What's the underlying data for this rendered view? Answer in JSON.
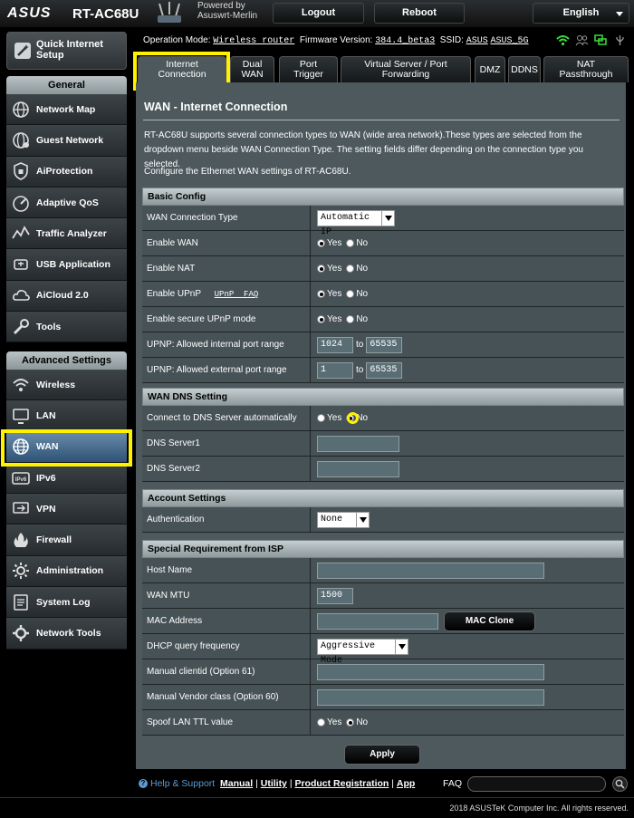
{
  "header": {
    "logo": "ASUS",
    "model": "RT-AC68U",
    "powered_by": "Powered by",
    "firmware_brand": "Asuswrt-Merlin",
    "logout": "Logout",
    "reboot": "Reboot",
    "language": "English"
  },
  "status": {
    "op_mode_label": "Operation Mode:",
    "op_mode": "Wireless router",
    "fw_label": "Firmware Version:",
    "fw": "384.4_beta3",
    "ssid_label": "SSID:",
    "ssid1": "ASUS",
    "ssid2": "ASUS_5G"
  },
  "sidebar": {
    "qis": "Quick Internet Setup",
    "general_head": "General",
    "general": [
      {
        "label": "Network Map",
        "icon": "network-map-icon"
      },
      {
        "label": "Guest Network",
        "icon": "guest-network-icon"
      },
      {
        "label": "AiProtection",
        "icon": "aiprotection-icon"
      },
      {
        "label": "Adaptive QoS",
        "icon": "qos-icon"
      },
      {
        "label": "Traffic Analyzer",
        "icon": "traffic-analyzer-icon"
      },
      {
        "label": "USB Application",
        "icon": "usb-icon"
      },
      {
        "label": "AiCloud 2.0",
        "icon": "cloud-icon"
      },
      {
        "label": "Tools",
        "icon": "tools-icon"
      }
    ],
    "advanced_head": "Advanced Settings",
    "advanced": [
      {
        "label": "Wireless",
        "icon": "wireless-icon"
      },
      {
        "label": "LAN",
        "icon": "lan-icon"
      },
      {
        "label": "WAN",
        "icon": "wan-globe-icon"
      },
      {
        "label": "IPv6",
        "icon": "ipv6-icon"
      },
      {
        "label": "VPN",
        "icon": "vpn-icon"
      },
      {
        "label": "Firewall",
        "icon": "firewall-icon"
      },
      {
        "label": "Administration",
        "icon": "administration-icon"
      },
      {
        "label": "System Log",
        "icon": "system-log-icon"
      },
      {
        "label": "Network Tools",
        "icon": "network-tools-icon"
      }
    ]
  },
  "tabs": [
    {
      "label1": "Internet",
      "label2": "Connection"
    },
    {
      "label1": "Dual",
      "label2": "WAN"
    },
    {
      "label1": "Port",
      "label2": "Trigger"
    },
    {
      "label1": "Virtual Server / Port",
      "label2": "Forwarding"
    },
    {
      "label1": "DMZ",
      "label2": ""
    },
    {
      "label1": "DDNS",
      "label2": ""
    },
    {
      "label1": "NAT",
      "label2": "Passthrough"
    }
  ],
  "main": {
    "title": "WAN - Internet Connection",
    "desc": "RT-AC68U supports several connection types to WAN (wide area network).These types are selected from the dropdown menu beside WAN Connection Type. The setting fields differ depending on the connection type you selected.",
    "desc2": "Configure the Ethernet WAN settings of RT-AC68U.",
    "yes": "Yes",
    "no": "No",
    "to": "to"
  },
  "basic": {
    "head": "Basic Config",
    "wan_type_label": "WAN Connection Type",
    "wan_type_value": "Automatic IP",
    "enable_wan_label": "Enable WAN",
    "enable_nat_label": "Enable NAT",
    "enable_upnp_label": "Enable UPnP",
    "upnp_faq": "UPnP  FAQ",
    "secure_upnp_label": "Enable secure UPnP mode",
    "internal_range_label": "UPNP: Allowed internal port range",
    "internal_from": "1024",
    "internal_to": "65535",
    "external_range_label": "UPNP: Allowed external port range",
    "external_from": "1",
    "external_to": "65535"
  },
  "dns": {
    "head": "WAN DNS Setting",
    "auto_label": "Connect to DNS Server automatically",
    "server1_label": "DNS Server1",
    "server1": "",
    "server2_label": "DNS Server2",
    "server2": ""
  },
  "account": {
    "head": "Account Settings",
    "auth_label": "Authentication",
    "auth_value": "None"
  },
  "isp": {
    "head": "Special Requirement from ISP",
    "host_label": "Host Name",
    "host": "",
    "mtu_label": "WAN MTU",
    "mtu": "1500",
    "mac_label": "MAC Address",
    "mac": "",
    "mac_clone": "MAC Clone",
    "dhcp_label": "DHCP query frequency",
    "dhcp_value": "Aggressive Mode",
    "clientid_label": "Manual clientid (Option 61)",
    "vendor_label": "Manual Vendor class (Option 60)",
    "ttl_label": "Spoof LAN TTL value"
  },
  "apply": "Apply",
  "footer": {
    "help": "Help & Support",
    "manual": "Manual",
    "utility": "Utility",
    "registration": "Product Registration",
    "app": "App",
    "faq": "FAQ",
    "copyright": "2018 ASUSTeK Computer Inc. All rights reserved."
  },
  "colors": {
    "highlight": "#fff200",
    "panel": "#4d595d",
    "active_item": "#4a6f93"
  }
}
